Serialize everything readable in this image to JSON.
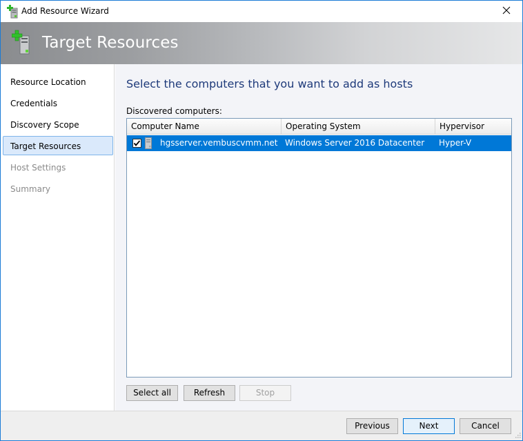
{
  "window": {
    "title": "Add Resource Wizard",
    "app_icon": "add-server-icon",
    "close_icon": "close-icon"
  },
  "banner": {
    "title": "Target Resources",
    "icon": "add-server-icon"
  },
  "sidebar": {
    "items": [
      {
        "label": "Resource Location",
        "state": "normal"
      },
      {
        "label": "Credentials",
        "state": "normal"
      },
      {
        "label": "Discovery Scope",
        "state": "normal"
      },
      {
        "label": "Target Resources",
        "state": "selected"
      },
      {
        "label": "Host Settings",
        "state": "disabled"
      },
      {
        "label": "Summary",
        "state": "disabled"
      }
    ]
  },
  "main": {
    "heading": "Select the computers that you want to add as hosts",
    "list_label": "Discovered computers:",
    "table": {
      "columns": [
        "Computer Name",
        "Operating System",
        "Hypervisor"
      ],
      "rows": [
        {
          "checked": true,
          "icon": "server-icon",
          "computer_name": "hgsserver.vembuscvmm.net",
          "operating_system": "Windows Server 2016 Datacenter",
          "hypervisor": "Hyper-V",
          "selected": true
        }
      ]
    },
    "buttons": {
      "select_all": "Select all",
      "refresh": "Refresh",
      "stop": "Stop"
    }
  },
  "footer": {
    "previous": "Previous",
    "next": "Next",
    "cancel": "Cancel"
  },
  "colors": {
    "accent": "#0078d7",
    "heading": "#1e3a7a",
    "selected_nav_bg": "#dae9fb",
    "selected_nav_border": "#7eb4ea",
    "window_border": "#1a7bd6"
  }
}
